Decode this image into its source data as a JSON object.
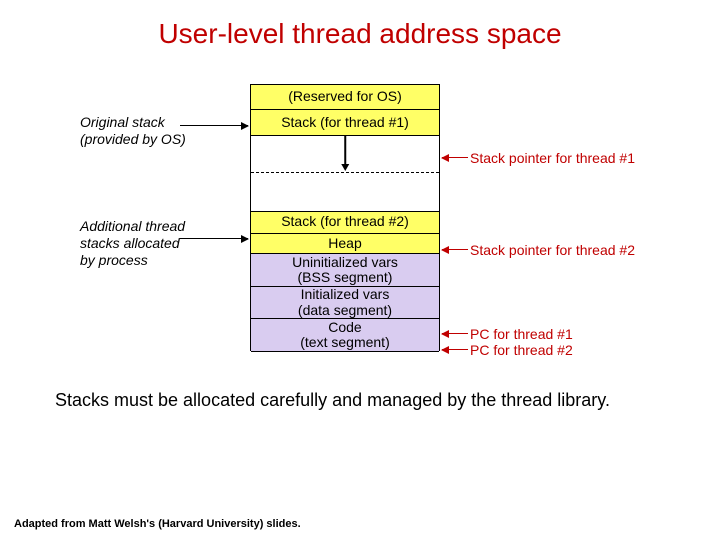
{
  "title": "User-level thread address space",
  "memory": {
    "reserved": "(Reserved for OS)",
    "stack1": "Stack (for thread #1)",
    "stack2": "Stack (for thread #2)",
    "heap": "Heap",
    "bss": "Uninitialized vars\n(BSS segment)",
    "data": "Initialized vars\n(data segment)",
    "text": "Code\n(text segment)"
  },
  "left": {
    "orig_stack": "Original stack\n(provided by OS)",
    "addl_stacks": "Additional thread\nstacks allocated\nby process"
  },
  "right": {
    "sp1": "Stack pointer for thread #1",
    "sp2": "Stack pointer for thread #2",
    "pc1": "PC for thread #1",
    "pc2": "PC for thread #2"
  },
  "note": "Stacks must be allocated carefully and managed by the thread library.",
  "credit": "Adapted from Matt Welsh's (Harvard University) slides."
}
